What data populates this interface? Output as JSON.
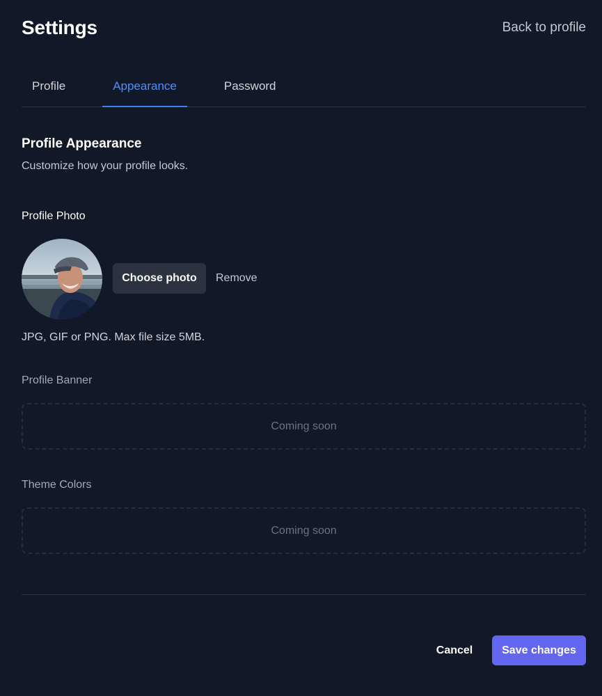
{
  "header": {
    "title": "Settings",
    "back_link": "Back to profile"
  },
  "tabs": [
    {
      "label": "Profile",
      "active": false
    },
    {
      "label": "Appearance",
      "active": true
    },
    {
      "label": "Password",
      "active": false
    }
  ],
  "section": {
    "title": "Profile Appearance",
    "description": "Customize how your profile looks."
  },
  "photo": {
    "label": "Profile Photo",
    "choose_label": "Choose photo",
    "remove_label": "Remove",
    "hint": "JPG, GIF or PNG. Max file size 5MB."
  },
  "banner": {
    "label": "Profile Banner",
    "placeholder": "Coming soon"
  },
  "theme": {
    "label": "Theme Colors",
    "placeholder": "Coming soon"
  },
  "footer": {
    "cancel_label": "Cancel",
    "save_label": "Save changes"
  },
  "colors": {
    "background": "#111827",
    "accent_tab": "#3b82f6",
    "primary_button": "#6366f1",
    "secondary_button": "#2b3340"
  }
}
